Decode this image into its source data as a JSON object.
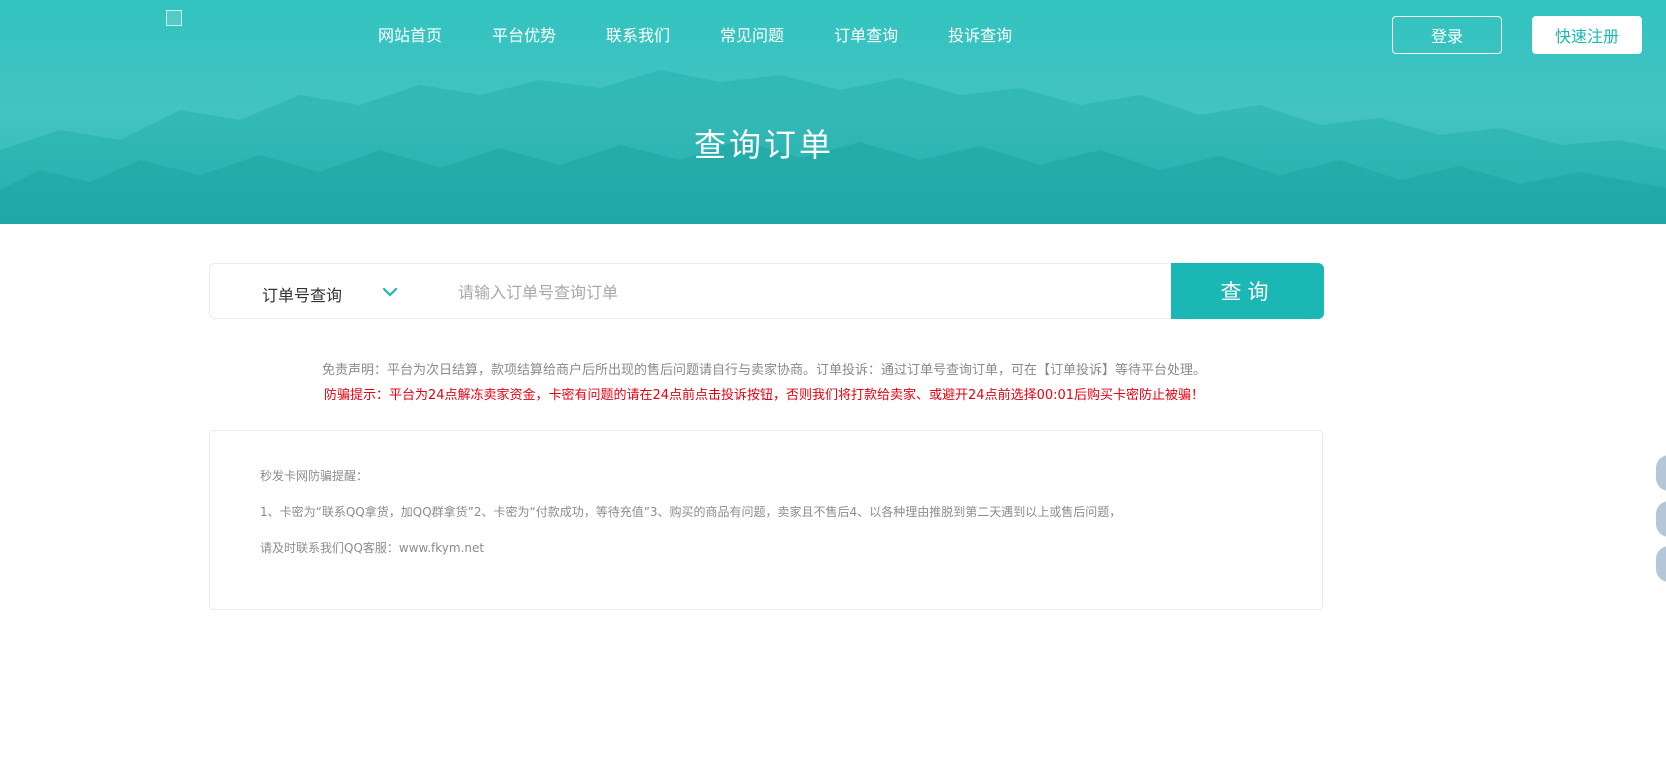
{
  "header": {
    "logo_alt": "",
    "nav": [
      "网站首页",
      "平台优势",
      "联系我们",
      "常见问题",
      "订单查询",
      "投诉查询"
    ],
    "login_label": "登录",
    "register_label": "快速注册"
  },
  "hero": {
    "title": "查询订单"
  },
  "search": {
    "type_label": "订单号查询",
    "placeholder": "请输入订单号查询订单",
    "button_label": "查询"
  },
  "notices": {
    "disclaimer": "免责声明：平台为次日结算，款项结算给商户后所出现的售后问题请自行与卖家协商。订单投诉：通过订单号查询订单，可在【订单投诉】等待平台处理。",
    "warning": "防骗提示：平台为24点解冻卖家资金，卡密有问题的请在24点前点击投诉按钮，否则我们将打款给卖家、或避开24点前选择00:01后购买卡密防止被骗！"
  },
  "anti_fraud": {
    "title": "秒发卡网防骗提醒：",
    "line1": "1、卡密为“联系QQ拿货，加QQ群拿货”2、卡密为“付款成功，等待充值”3、购买的商品有问题，卖家且不售后4、以各种理由推脱到第二天遇到以上或售后问题，",
    "line2": "请及时联系我们QQ客服：www.fkym.net"
  },
  "colors": {
    "accent": "#1ab7b4",
    "warning": "#e60012"
  }
}
